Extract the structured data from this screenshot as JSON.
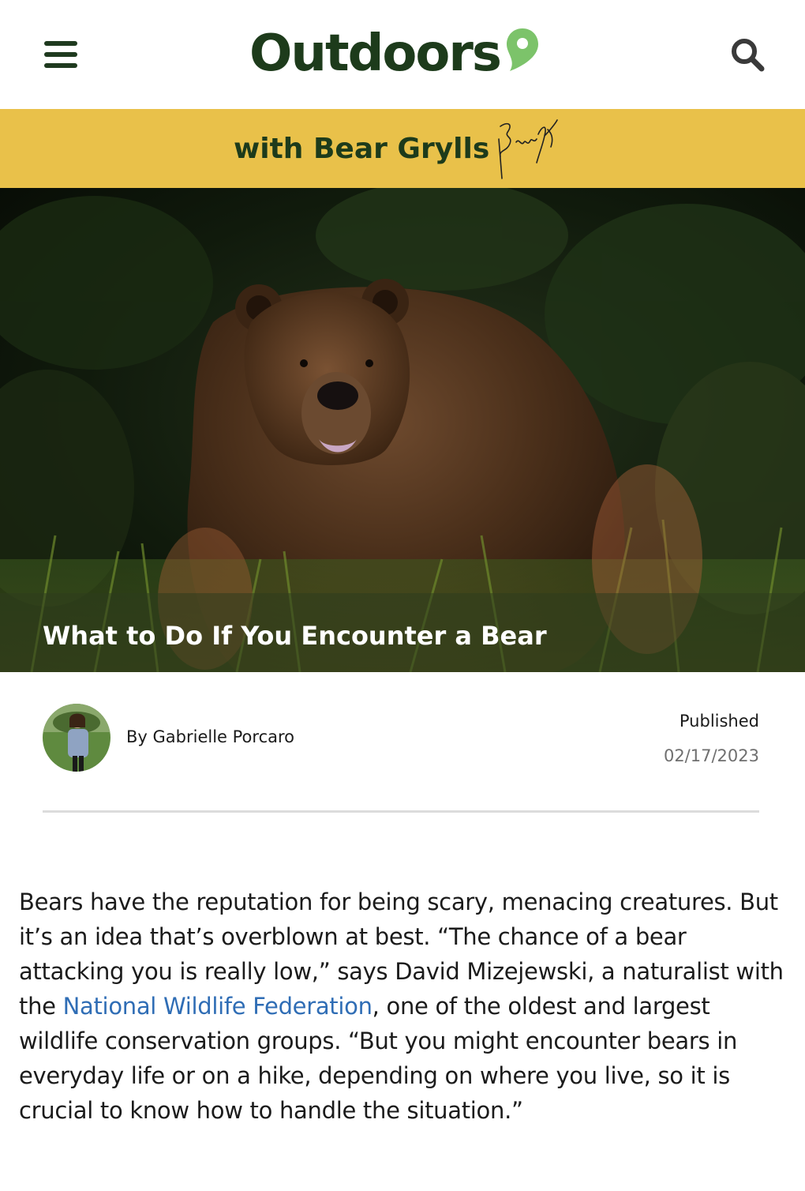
{
  "header": {
    "logo_text": "Outdoors",
    "menu_icon": "hamburger-menu-icon",
    "search_icon": "search-icon",
    "logo_pin_icon": "map-pin-icon"
  },
  "banner": {
    "text": "with Bear Grylls",
    "signature_text": "Bear Grylls",
    "background_color": "#e9c14a"
  },
  "hero": {
    "title": "What to Do If You Encounter a Bear"
  },
  "byline": {
    "author": "By Gabrielle Porcaro",
    "published_label": "Published",
    "published_date": "02/17/2023"
  },
  "article": {
    "p1_before_link": "Bears have the reputation for being scary, menacing creatures. But it’s an idea that’s overblown at best. “The chance of a bear attacking you is really low,” says David Mizejewski, a naturalist with the ",
    "p1_link": "National Wildlife Federation",
    "p1_after_link": ", one of the oldest and largest wildlife conservation groups. “But you might encounter bears in everyday life or on a hike, depending on where you live, so it is crucial to know how to handle the situation.”"
  },
  "colors": {
    "brand_green": "#1d3b1b",
    "pin_green": "#7cc36a",
    "link_blue": "#2f6db5"
  }
}
